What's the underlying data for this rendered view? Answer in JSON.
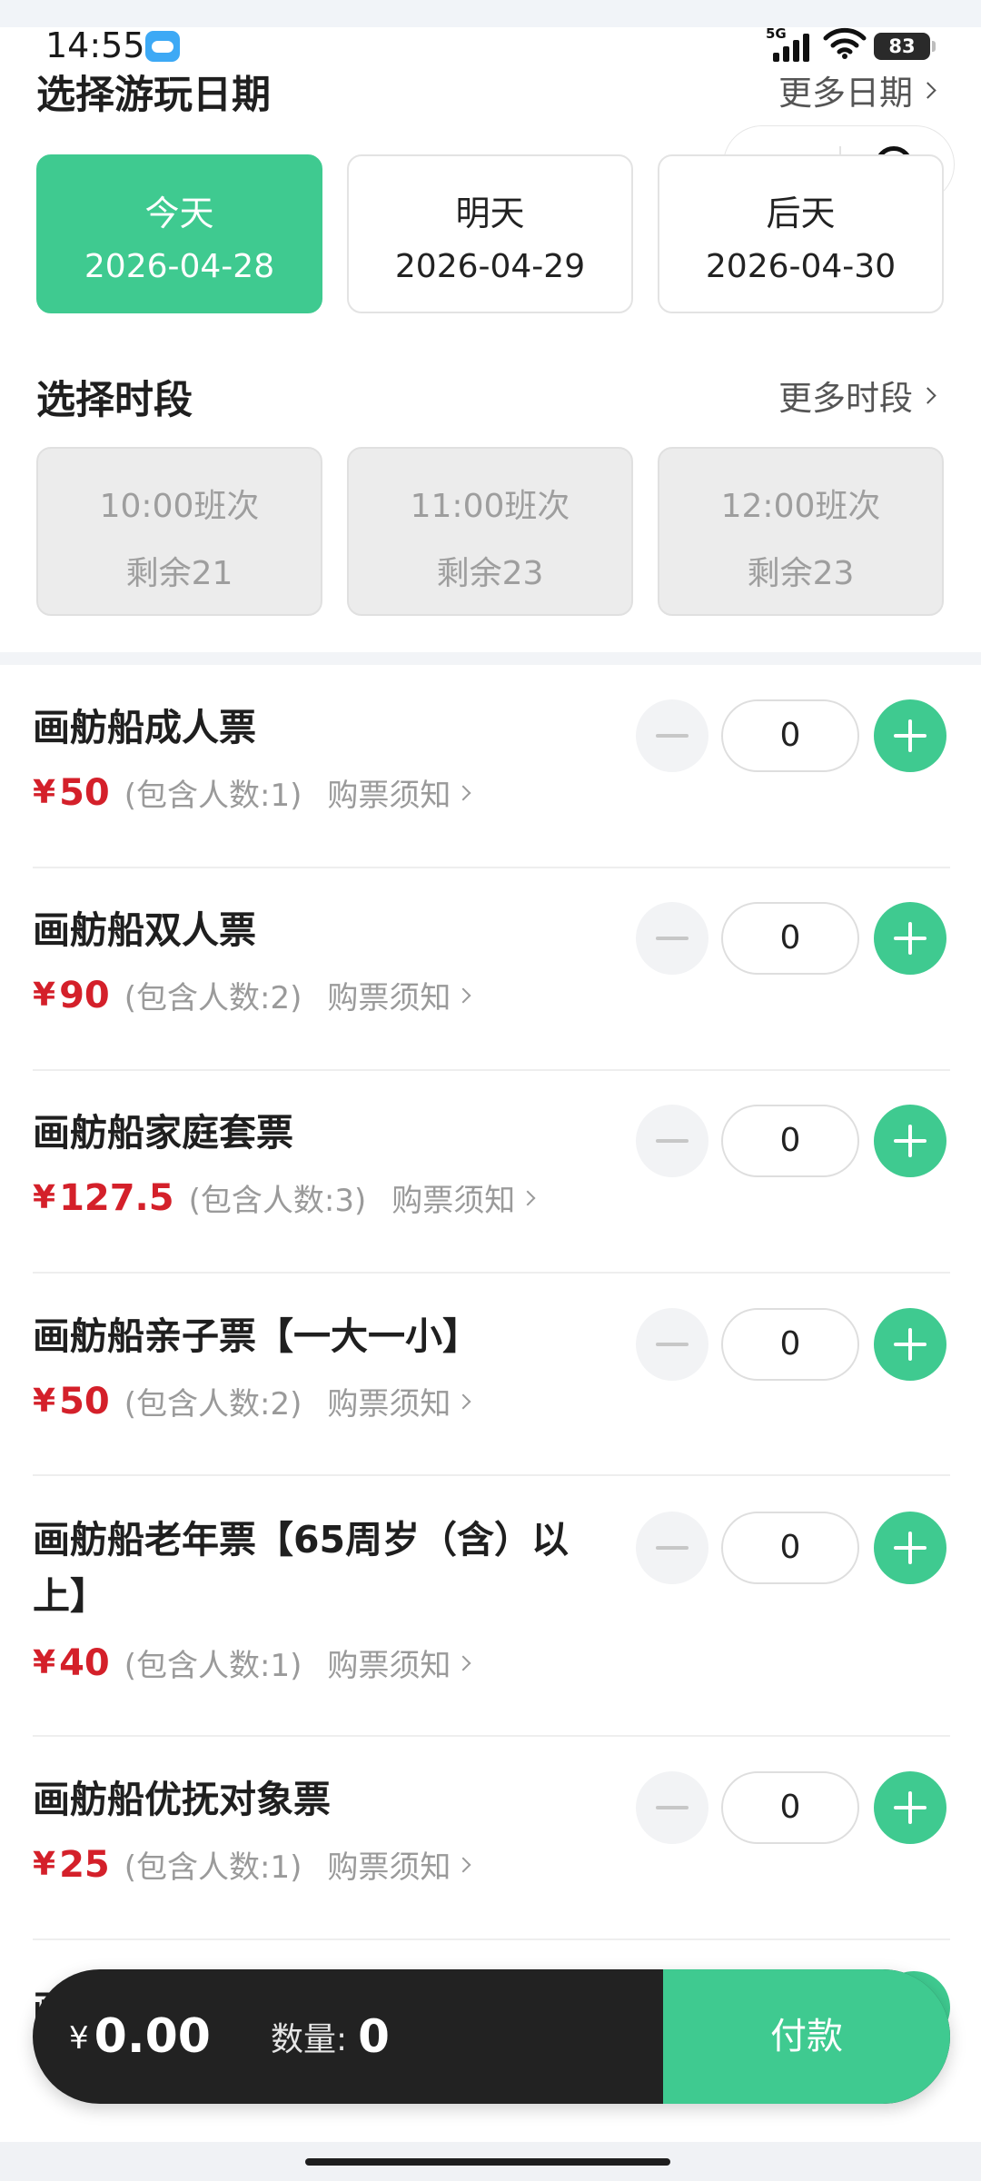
{
  "status_bar": {
    "time": "14:55",
    "network": "5G",
    "battery": "83"
  },
  "date_section": {
    "title": "选择游玩日期",
    "more": "更多日期"
  },
  "dates": [
    {
      "label": "今天",
      "date": "2026-04-28",
      "selected": true
    },
    {
      "label": "明天",
      "date": "2026-04-29",
      "selected": false
    },
    {
      "label": "后天",
      "date": "2026-04-30",
      "selected": false
    }
  ],
  "slot_section": {
    "title": "选择时段",
    "more": "更多时段"
  },
  "slots": [
    {
      "time": "10:00班次",
      "remaining": "剩余21"
    },
    {
      "time": "11:00班次",
      "remaining": "剩余23"
    },
    {
      "time": "12:00班次",
      "remaining": "剩余23"
    }
  ],
  "currency": "¥",
  "tickets": [
    {
      "name": "画舫船成人票",
      "price": "50",
      "people": "(包含人数:1)",
      "notice": "购票须知",
      "qty": "0"
    },
    {
      "name": "画舫船双人票",
      "price": "90",
      "people": "(包含人数:2)",
      "notice": "购票须知",
      "qty": "0"
    },
    {
      "name": "画舫船家庭套票",
      "price": "127.5",
      "people": "(包含人数:3)",
      "notice": "购票须知",
      "qty": "0"
    },
    {
      "name": "画舫船亲子票【一大一小】",
      "price": "50",
      "people": "(包含人数:2)",
      "notice": "购票须知",
      "qty": "0"
    },
    {
      "name": "画舫船老年票【65周岁（含）以上】",
      "price": "40",
      "people": "(包含人数:1)",
      "notice": "购票须知",
      "qty": "0"
    },
    {
      "name": "画舫船优抚对象票",
      "price": "25",
      "people": "(包含人数:1)",
      "notice": "购票须知",
      "qty": "0"
    }
  ],
  "peek_ticket": {
    "name_fragment": "画"
  },
  "bottom_bar": {
    "total": "0.00",
    "qty_label": "数量:",
    "qty_value": "0",
    "pay_label": "付款"
  },
  "colors": {
    "accent": "#3fca90",
    "price_red": "#d4202a",
    "bar_dark": "#222222"
  }
}
